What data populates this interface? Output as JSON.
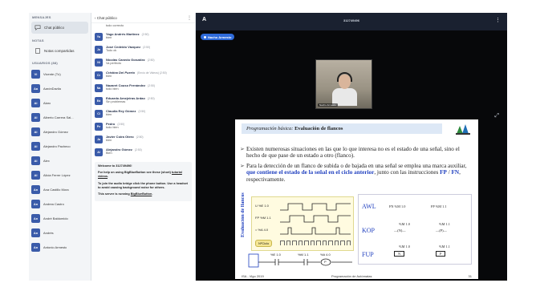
{
  "sidebar": {
    "messages_title": "MENSAJES",
    "public_chat": "Chat público",
    "notes_title": "NOTAS",
    "shared_notes": "Notas compartidas",
    "users_title": "USUARIOS (88)",
    "users": [
      {
        "initials": "Vi",
        "name": "Vicente (Tú)"
      },
      {
        "initials": "Aa",
        "name": "AarónDavila"
      },
      {
        "initials": "Al",
        "name": "Alaro"
      },
      {
        "initials": "Al",
        "name": "Alberto Carrera Sal..."
      },
      {
        "initials": "Al",
        "name": "Alejandro Gómez"
      },
      {
        "initials": "Al",
        "name": "Alejandro Pacheco"
      },
      {
        "initials": "Al",
        "name": "Alex"
      },
      {
        "initials": "Al",
        "name": "Alicia Ferrer López"
      },
      {
        "initials": "An",
        "name": "Ana Castillo Mora"
      },
      {
        "initials": "An",
        "name": "Andrea Castro"
      },
      {
        "initials": "An",
        "name": "André Baldomido"
      },
      {
        "initials": "An",
        "name": "Andrés"
      },
      {
        "initials": "An",
        "name": "Antonio Armesto"
      }
    ]
  },
  "chat": {
    "back_label": "‹  Chat público",
    "more": "⋮",
    "first_text": "todo correcto",
    "messages": [
      {
        "initials": "Yu",
        "name": "Yago Andrés Martínez",
        "time": "(2:50)",
        "text": "bien"
      },
      {
        "initials": "Jo",
        "name": "José Cedeido Vázquez",
        "time": "(2:50)",
        "text": "Todo ok"
      },
      {
        "initials": "Ni",
        "name": "Nicolás Canedo González",
        "time": "(2:50)",
        "text": "Va perfecto"
      },
      {
        "initials": "Cr",
        "name": "Cristina Del Puerto",
        "time": "(Envío de Videos)  (2:50)",
        "text": "bien"
      },
      {
        "initials": "Na",
        "name": "Nazaret Couso Fernández",
        "time": "(2:50)",
        "text": "todo bien"
      },
      {
        "initials": "Ed",
        "name": "Eduardo Amejeiras Ardao",
        "time": "(2:50)",
        "text": "Sin problemas"
      },
      {
        "initials": "Cl",
        "name": "Claudia Rey Gómez",
        "time": "(2:50)",
        "text": "bien"
      },
      {
        "initials": "Pe",
        "name": "Pedro",
        "time": "(2:50)",
        "text": "todo bien"
      },
      {
        "initials": "Ja",
        "name": "Javier Coira Otero",
        "time": "(2:50)",
        "text": "bien"
      },
      {
        "initials": "Al",
        "name": "Alejandro Gómez",
        "time": "(2:50)",
        "text": "Bien"
      }
    ],
    "welcome": {
      "line1": "Welcome to 312749496!",
      "line2a": "For help on using BigBlueButton see these (short) ",
      "line2b": "tutorial videos",
      "line3": "To join the audio bridge click the phone button. Use a headset to avoid causing background noise for others.",
      "line4a": "This server is running ",
      "line4b": "BigBlueButton"
    }
  },
  "main": {
    "logo": "A",
    "meeting_name": "312749496",
    "more": "⋮",
    "presenter": "Nacho Armesto",
    "webcam_label": "Nacho Armesto",
    "fullscreen": "⤢"
  },
  "slide": {
    "header_italic": "Programación básica:",
    "header_bold": "Evaluación de flancos",
    "bullet1": "Existen numerosas situaciones en las que lo que interesa no es el estado de una señal, sino el hecho de que pase de un estado a otro (flanco).",
    "bullet2a": "Para la detección de un flanco de subida o de bajada en una señal se emplea una marca auxiliar, ",
    "bullet2b": "que contiene el estado de la señal en el ciclo anterior",
    "bullet2c": ", junto con las instrucciones ",
    "bullet2d": "FP",
    "bullet2e": "FN",
    "bullet2f": ", respectivamente.",
    "side_label": "Evaluación de flancos",
    "ladder": {
      "sig1": "U   %E 1.0",
      "sig2": "FP  %M 1.1",
      "sig3": "=   %A 4.0",
      "cycle": "NºCiclo"
    },
    "instr": {
      "awl": "AWL",
      "awl_fp": "FN %M 1.0",
      "awl_fn": "FP %M 1.1",
      "kop": "KOP",
      "kop_m1": "%M 1.0",
      "kop_m2": "%M 1.1",
      "kop_c1": "—(N)—",
      "kop_c2": "—(P)—",
      "fup": "FUP",
      "fup_m1": "%M 1.0",
      "fup_m2": "%M 1.1",
      "fup_b1": "N",
      "fup_b2": "P"
    },
    "contact": {
      "c1": "%E 1.0",
      "c2": "%M 1.1",
      "c3": "%A 4.0",
      "coil": "P"
    },
    "footer_left": "ISA - Vigo 2019",
    "footer_mid": "Programación de Autómatas",
    "footer_right": "31"
  }
}
